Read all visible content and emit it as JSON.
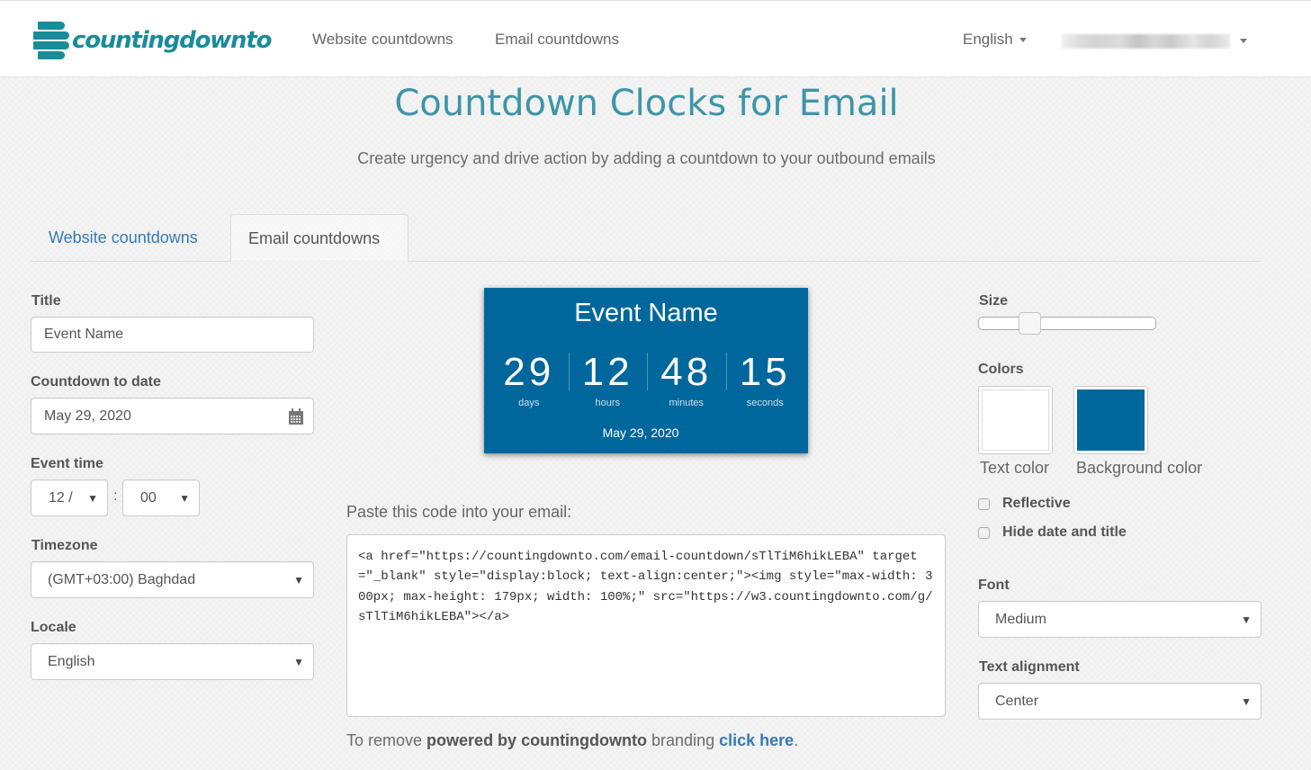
{
  "nav": {
    "logo_text": "countingdownto",
    "links": [
      "Website countdowns",
      "Email countdowns"
    ],
    "language": "English",
    "user_menu_redacted": true
  },
  "header": {
    "title": "Countdown Clocks for Email",
    "subtitle": "Create urgency and drive action by adding a countdown to your outbound emails"
  },
  "tabs": [
    {
      "label": "Website countdowns",
      "active": false
    },
    {
      "label": "Email countdowns",
      "active": true
    }
  ],
  "form": {
    "title": {
      "label": "Title",
      "value": "Event Name"
    },
    "date": {
      "label": "Countdown to date",
      "value": "May 29, 2020",
      "icon": "calendar-icon"
    },
    "time": {
      "label": "Event time",
      "hour": "12 /",
      "separator": ":",
      "minute": "00"
    },
    "timezone": {
      "label": "Timezone",
      "value": "(GMT+03:00) Baghdad"
    },
    "locale": {
      "label": "Locale",
      "value": "English"
    }
  },
  "preview": {
    "title": "Event Name",
    "units": [
      {
        "value": "29",
        "label": "days"
      },
      {
        "value": "12",
        "label": "hours"
      },
      {
        "value": "48",
        "label": "minutes"
      },
      {
        "value": "15",
        "label": "seconds"
      }
    ],
    "date": "May 29, 2020",
    "background_color": "#00679c",
    "text_color": "#ffffff"
  },
  "code": {
    "label": "Paste this code into your email:",
    "value": "<a href=\"https://countingdownto.com/email-countdown/sTlTiM6hikLEBA\" target=\"_blank\" style=\"display:block; text-align:center;\"><img style=\"max-width: 300px; max-height: 179px; width: 100%;\" src=\"https://w3.countingdownto.com/g/sTlTiM6hikLEBA\"></a>"
  },
  "branding": {
    "prefix": "To remove ",
    "bold": "powered by countingdownto",
    "middle": " branding ",
    "link": "click here",
    "suffix": "."
  },
  "settings": {
    "size": {
      "label": "Size",
      "value_fraction": 0.23
    },
    "colors": {
      "label": "Colors",
      "text_color": {
        "label": "Text color",
        "value": "#ffffff"
      },
      "background_color": {
        "label": "Background color",
        "value": "#00679c"
      }
    },
    "reflective": {
      "label": "Reflective",
      "checked": false
    },
    "hide_date_title": {
      "label": "Hide date and title",
      "checked": false
    },
    "font": {
      "label": "Font",
      "value": "Medium"
    },
    "alignment": {
      "label": "Text alignment",
      "value": "Center"
    }
  },
  "icons": {
    "select_arrow": "▼"
  }
}
